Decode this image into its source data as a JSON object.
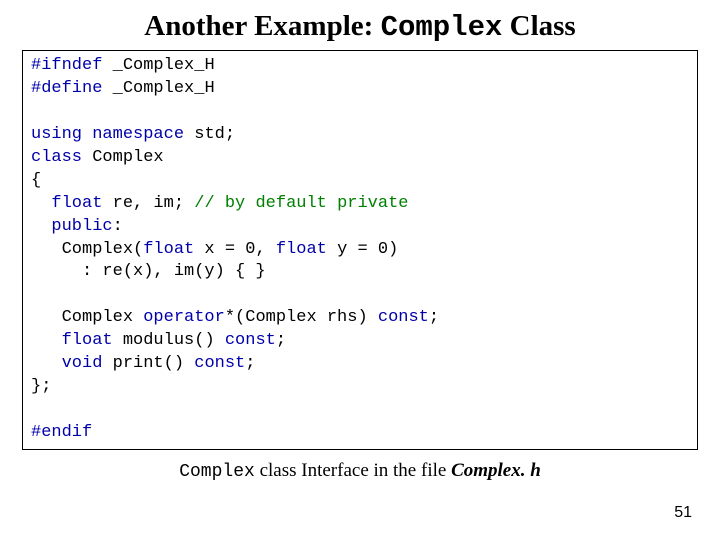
{
  "title": {
    "pre": "Another Example: ",
    "mono": "Complex",
    "post": " Class"
  },
  "code": {
    "l01a": "#ifndef",
    "l01b": " _Complex_H",
    "l02a": "#define",
    "l02b": " _Complex_H",
    "l03": "",
    "l04a": "using",
    "l04b": " ",
    "l04c": "namespace",
    "l04d": " std;",
    "l05a": "class",
    "l05b": " Complex",
    "l06": "{",
    "l07a": "  ",
    "l07b": "float",
    "l07c": " re, im; ",
    "l07d": "// by default private",
    "l08a": "  ",
    "l08b": "public",
    "l08c": ":",
    "l09a": "   Complex(",
    "l09b": "float",
    "l09c": " x = 0, ",
    "l09d": "float",
    "l09e": " y = 0)",
    "l10": "     : re(x), im(y) { }",
    "l11": "",
    "l12a": "   Complex ",
    "l12b": "operator",
    "l12c": "*(Complex rhs) ",
    "l12d": "const",
    "l12e": ";",
    "l13a": "   ",
    "l13b": "float",
    "l13c": " modulus() ",
    "l13d": "const",
    "l13e": ";",
    "l14a": "   ",
    "l14b": "void",
    "l14c": " print() ",
    "l14d": "const",
    "l14e": ";",
    "l15": "};",
    "l16": "",
    "l17": "#endif"
  },
  "caption": {
    "mono": "Complex",
    "mid": "  class Interface in the file ",
    "fname": "Complex. h"
  },
  "page_number": "51"
}
